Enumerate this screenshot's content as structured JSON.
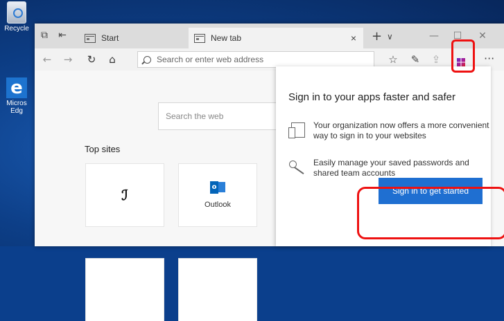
{
  "desktop": {
    "icons": [
      {
        "label": "Recycle",
        "icon": "recycle-bin-icon"
      },
      {
        "label": "Micros Edg",
        "icon": "edge-icon"
      }
    ]
  },
  "browser": {
    "tabs": [
      {
        "label": "Start",
        "active": false
      },
      {
        "label": "New tab",
        "active": true
      }
    ],
    "tab_close": "×",
    "new_tab": "+",
    "tab_list": "∨",
    "window_buttons": {
      "minimize": "—",
      "maximize": "☐",
      "close": "✕"
    },
    "nav": {
      "back": "←",
      "forward": "→",
      "refresh": "↻",
      "home": "⌂"
    },
    "address_placeholder": "Search or enter web address",
    "toolbar": {
      "favorites": "☆",
      "notes": "✎",
      "share": "⇪",
      "extension_icon": "microsoft-apps-icon",
      "more": "···"
    }
  },
  "newtab": {
    "web_search_placeholder": "Search the web",
    "top_sites_label": "Top sites",
    "sites": [
      {
        "label": "",
        "icon": "app-logo-icon"
      },
      {
        "label": "Outlook",
        "icon": "outlook-icon"
      }
    ]
  },
  "popup": {
    "title": "Sign in to your apps faster and safer",
    "features": [
      {
        "icon": "device-icon",
        "text": "Your organization now offers a more convenient way to sign in to your websites"
      },
      {
        "icon": "key-icon",
        "text": "Easily manage your saved passwords and shared team accounts"
      }
    ],
    "button_label": "Sign in to get started"
  },
  "colors": {
    "accent": "#1f6fd1",
    "highlight": "#e11111",
    "desktop": "#0d3f88"
  }
}
